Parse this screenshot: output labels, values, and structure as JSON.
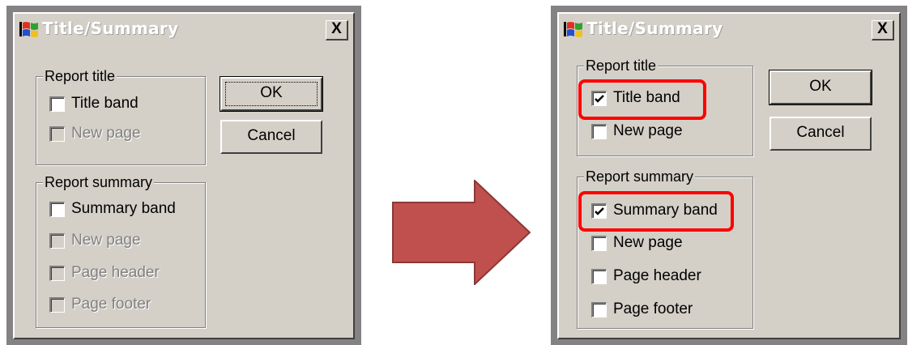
{
  "colors": {
    "dialog_face": "#d4d0c8",
    "frame_gray": "#848284",
    "title_text": "#ffffff",
    "highlight": "#ff0000",
    "arrow_fill": "#c0504d",
    "arrow_stroke": "#8c3836"
  },
  "before": {
    "title": "Title/Summary",
    "close_label": "X",
    "report_title": {
      "legend": "Report title",
      "title_band": "Title band",
      "new_page": "New page"
    },
    "report_summary": {
      "legend": "Report summary",
      "summary_band": "Summary band",
      "new_page": "New page",
      "page_header": "Page header",
      "page_footer": "Page footer"
    },
    "ok_label": "OK",
    "cancel_label": "Cancel",
    "checked": {
      "title_band": false,
      "summary_band": false
    },
    "icon": "windows-logo-icon"
  },
  "after": {
    "title": "Title/Summary",
    "close_label": "X",
    "report_title": {
      "legend": "Report title",
      "title_band": "Title band",
      "new_page": "New page"
    },
    "report_summary": {
      "legend": "Report summary",
      "summary_band": "Summary band",
      "new_page": "New page",
      "page_header": "Page header",
      "page_footer": "Page footer"
    },
    "ok_label": "OK",
    "cancel_label": "Cancel",
    "checked": {
      "title_band": true,
      "summary_band": true
    },
    "icon": "windows-logo-icon"
  },
  "arrow_icon": "right-arrow-icon"
}
